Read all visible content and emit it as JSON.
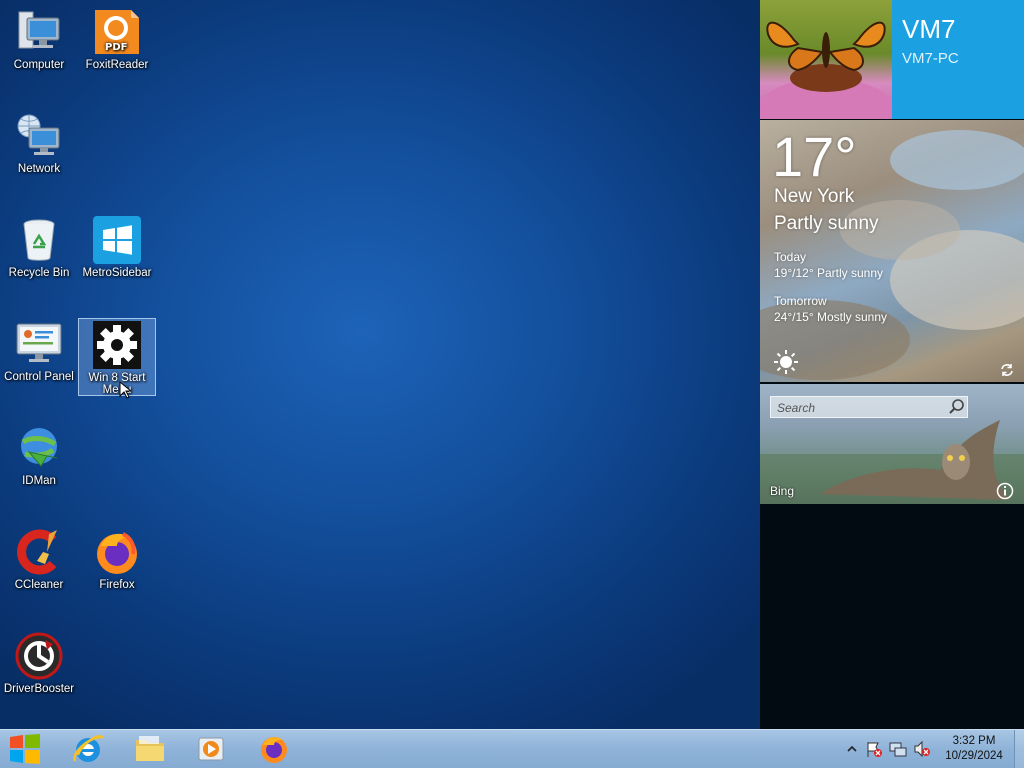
{
  "desktop": {
    "icons": [
      {
        "label": "Computer"
      },
      {
        "label": "FoxitReader"
      },
      {
        "label": "Network"
      },
      {
        "label": "Recycle Bin"
      },
      {
        "label": "MetroSidebar"
      },
      {
        "label": "Control Panel"
      },
      {
        "label": "Win 8 Start Menu"
      },
      {
        "label": "IDMan"
      },
      {
        "label": "CCleaner"
      },
      {
        "label": "Firefox"
      },
      {
        "label": "DriverBooster"
      }
    ]
  },
  "sidebar": {
    "user": {
      "name": "VM7",
      "pc_name": "VM7-PC"
    },
    "weather": {
      "temperature": "17°",
      "city": "New York",
      "condition": "Partly sunny",
      "today_label": "Today",
      "today_forecast": "19°/12° Partly sunny",
      "tomorrow_label": "Tomorrow",
      "tomorrow_forecast": "24°/15° Mostly sunny"
    },
    "bing": {
      "search_placeholder": "Search",
      "label": "Bing"
    }
  },
  "taskbar": {
    "start_icon": "windows-logo-icon",
    "pinned": [
      "internet-explorer-icon",
      "file-explorer-icon",
      "media-player-icon",
      "firefox-icon"
    ],
    "clock": {
      "time": "3:32 PM",
      "date": "10/29/2024"
    },
    "tray_icons": [
      "show-hidden-icons-chevron",
      "action-center-flag-icon",
      "network-icon",
      "volume-muted-icon"
    ]
  },
  "colors": {
    "accent": "#1ba1e2",
    "desktop_blue": "#134f9c",
    "taskbar": "#8fb3d8"
  }
}
